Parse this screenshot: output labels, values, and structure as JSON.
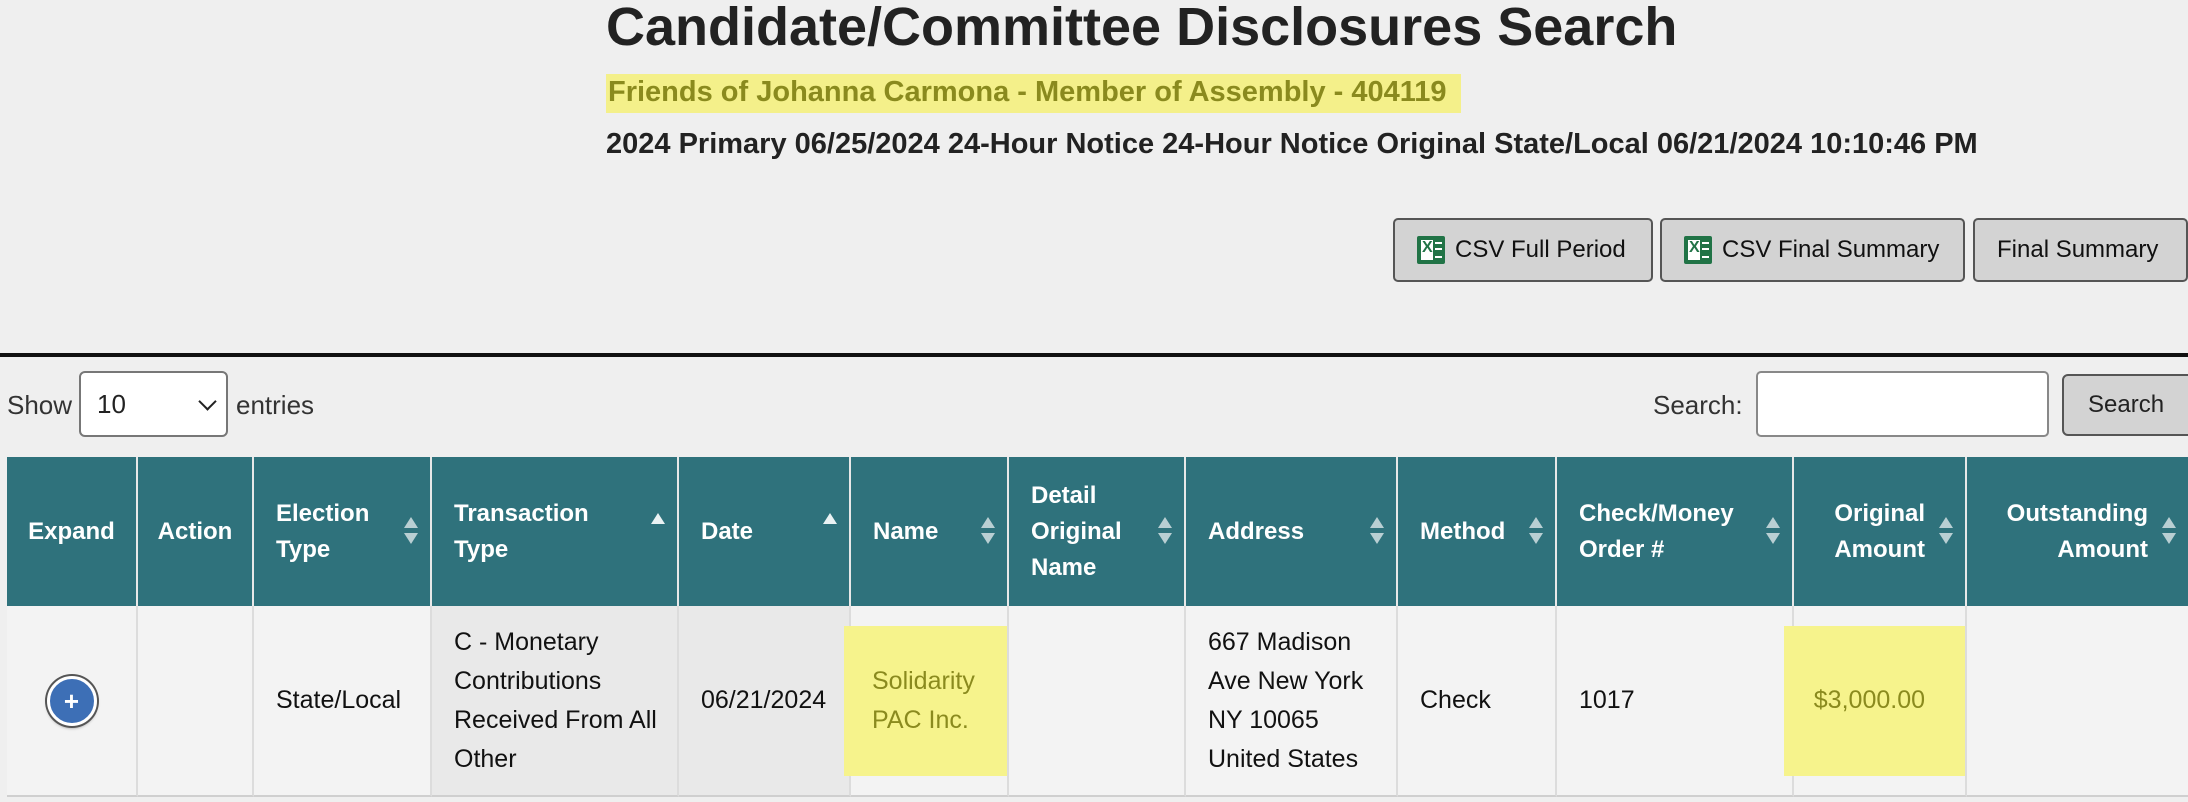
{
  "page": {
    "title": "Candidate/Committee Disclosures Search",
    "committee": "Friends of Johanna Carmona - Member of Assembly - 404119",
    "filing_info": "2024 Primary 06/25/2024 24-Hour Notice 24-Hour Notice Original State/Local 06/21/2024 10:10:46 PM"
  },
  "actions": {
    "csv_full_period": "CSV Full Period",
    "csv_final_summary": "CSV Final Summary",
    "final_summary": "Final Summary"
  },
  "controls": {
    "show_label": "Show",
    "entries_value": "10",
    "entries_label": "entries",
    "search_label": "Search:",
    "search_value": "",
    "search_button": "Search"
  },
  "table": {
    "headers": {
      "expand": "Expand",
      "action": "Action",
      "election_type": "Election Type",
      "transaction_type": "Transaction Type",
      "date": "Date",
      "name": "Name",
      "detail_original_name": "Detail Original Name",
      "address": "Address",
      "method": "Method",
      "check_number": "Check/Money Order #",
      "original_amount": "Original Amount",
      "outstanding_amount": "Outstanding Amount"
    },
    "rows": [
      {
        "expand": "+",
        "action": "",
        "election_type": "State/Local",
        "transaction_type": "C - Monetary Contributions Received From All Other",
        "date": "06/21/2024",
        "name": "Solidarity PAC Inc.",
        "detail_original_name": "",
        "address": "667 Madison Ave New York NY 10065 United States",
        "method": "Check",
        "check_number": "1017",
        "original_amount": "$3,000.00",
        "outstanding_amount": ""
      }
    ]
  },
  "icons": {
    "excel": "excel-file-icon",
    "dropdown": "chevron-down-icon",
    "sort": "sort-both-icon",
    "sort_asc": "sort-asc-icon",
    "expand": "plus-circle-icon"
  },
  "colors": {
    "header_bg": "#2f727c",
    "highlight_bg": "#f6f38c",
    "highlight_text": "#8a8a1e",
    "expand_button": "#3d6fb6",
    "excel_green": "#217346"
  }
}
